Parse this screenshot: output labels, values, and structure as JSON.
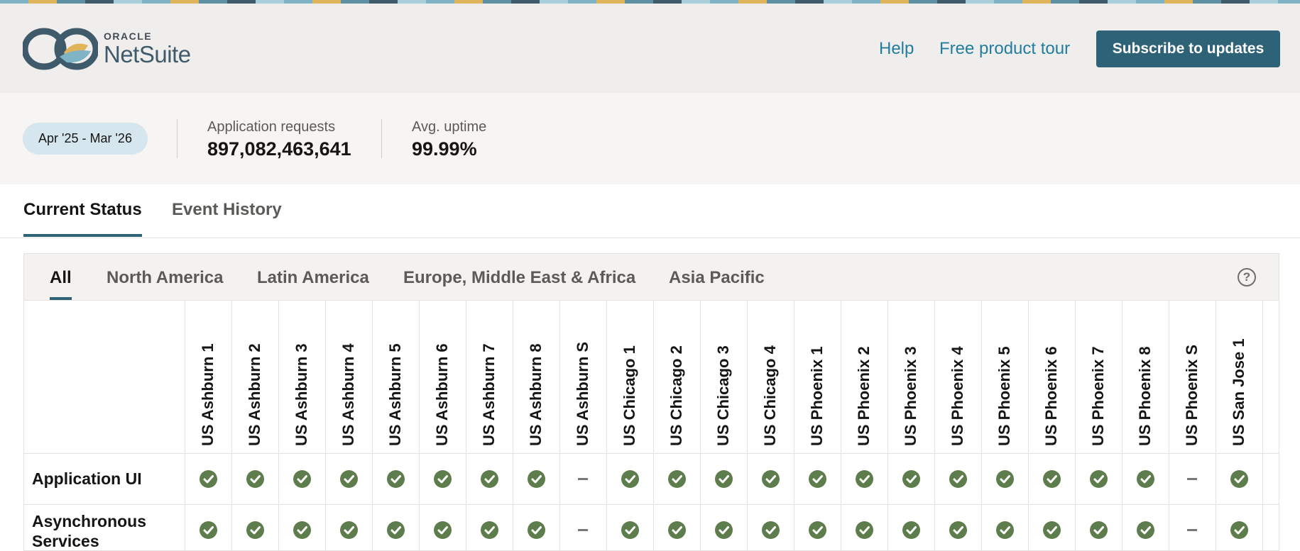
{
  "header": {
    "logo": {
      "oracle": "ORACLE",
      "netsuite": "NetSuite"
    },
    "links": {
      "help": "Help",
      "tour": "Free product tour"
    },
    "subscribe_label": "Subscribe to updates"
  },
  "stats": {
    "date_range": "Apr '25 - Mar '26",
    "requests_label": "Application requests",
    "requests_value": "897,082,463,641",
    "uptime_label": "Avg. uptime",
    "uptime_value": "99.99%"
  },
  "main_tabs": [
    "Current Status",
    "Event History"
  ],
  "region_tabs": [
    "All",
    "North America",
    "Latin America",
    "Europe, Middle East & Africa",
    "Asia Pacific"
  ],
  "help_icon_glyph": "?",
  "colors": {
    "accent": "#2e6377",
    "link": "#227e9e",
    "ok": "#5e7d4d",
    "pill": "#d5e6ee"
  },
  "status_legend": {
    "ok": "check-circle-icon",
    "na": "dash-icon"
  },
  "datacenters": [
    "US Ashburn 1",
    "US Ashburn 2",
    "US Ashburn 3",
    "US Ashburn 4",
    "US Ashburn 5",
    "US Ashburn 6",
    "US Ashburn 7",
    "US Ashburn 8",
    "US Ashburn S",
    "US Chicago 1",
    "US Chicago 2",
    "US Chicago 3",
    "US Chicago 4",
    "US Phoenix 1",
    "US Phoenix 2",
    "US Phoenix 3",
    "US Phoenix 4",
    "US Phoenix 5",
    "US Phoenix 6",
    "US Phoenix 7",
    "US Phoenix 8",
    "US Phoenix S",
    "US San Jose 1"
  ],
  "services": [
    {
      "name": "Application UI",
      "status": [
        "ok",
        "ok",
        "ok",
        "ok",
        "ok",
        "ok",
        "ok",
        "ok",
        "na",
        "ok",
        "ok",
        "ok",
        "ok",
        "ok",
        "ok",
        "ok",
        "ok",
        "ok",
        "ok",
        "ok",
        "ok",
        "na",
        "ok"
      ]
    },
    {
      "name": "Asynchronous Services",
      "status": [
        "ok",
        "ok",
        "ok",
        "ok",
        "ok",
        "ok",
        "ok",
        "ok",
        "na",
        "ok",
        "ok",
        "ok",
        "ok",
        "ok",
        "ok",
        "ok",
        "ok",
        "ok",
        "ok",
        "ok",
        "ok",
        "na",
        "ok"
      ]
    }
  ]
}
